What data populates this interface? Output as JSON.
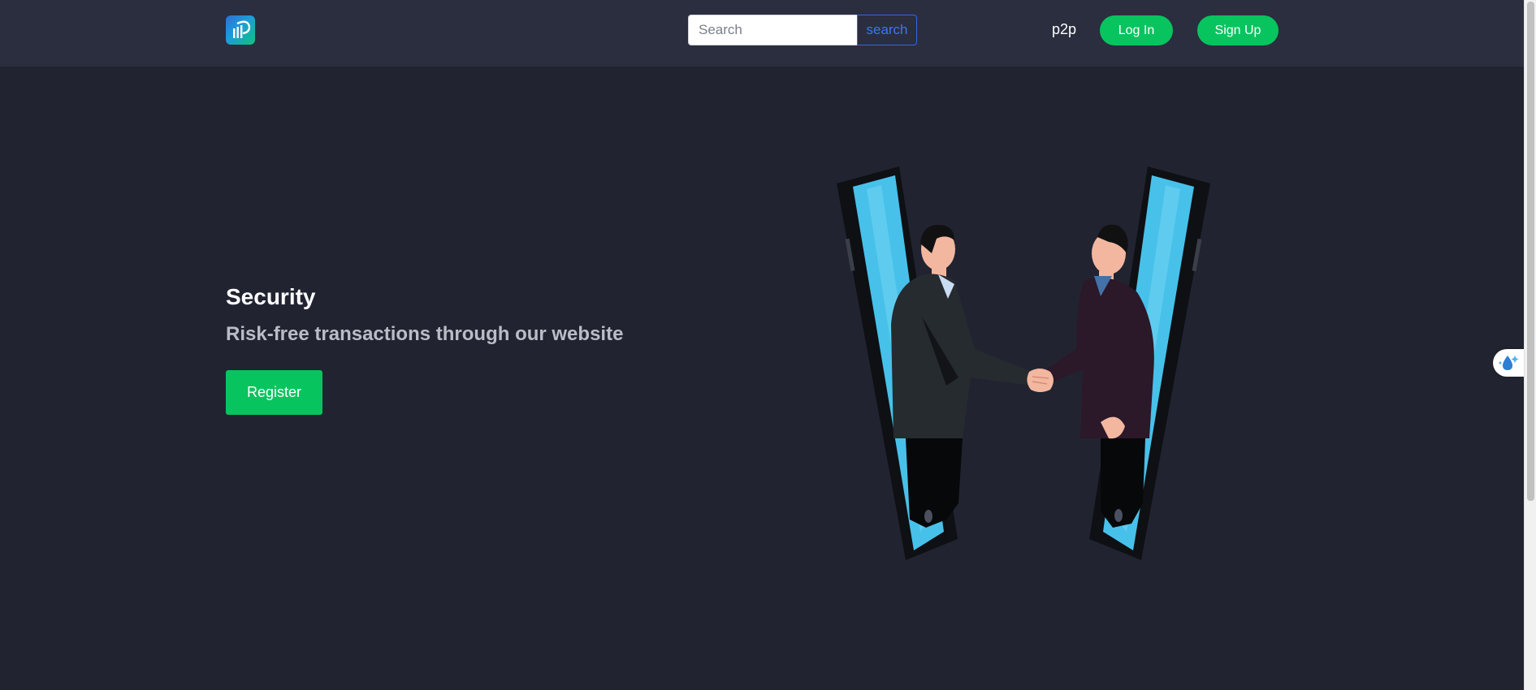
{
  "header": {
    "logo_icon": "p2p-logo-icon",
    "search": {
      "placeholder": "Search",
      "value": "",
      "button_label": "search"
    },
    "nav_link": "p2p",
    "login_label": "Log In",
    "signup_label": "Sign Up"
  },
  "hero": {
    "title": "Security",
    "subtitle": "Risk-free transactions through our website",
    "register_label": "Register",
    "illustration": "handshake-through-phones-illustration"
  },
  "widget": {
    "icon": "water-drop-sparkle-icon"
  },
  "colors": {
    "background": "#212430",
    "header": "#2a2e3f",
    "accent_green": "#08c45e",
    "search_blue": "#3a78f0",
    "phone_screen": "#47c1ea"
  }
}
